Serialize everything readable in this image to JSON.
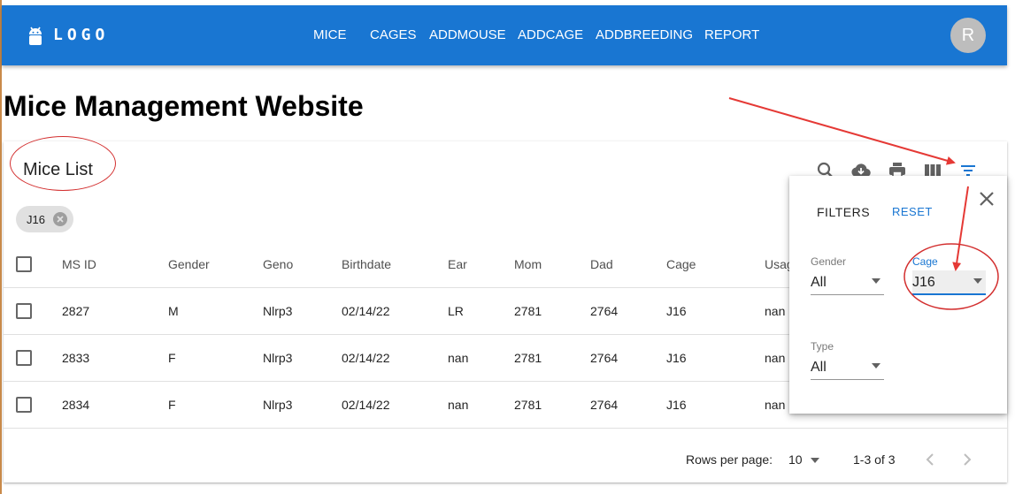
{
  "appbar": {
    "logo_text": "LOGO",
    "logo_icon": "android-icon",
    "nav": [
      "MICE",
      "CAGES",
      "ADDMOUSE",
      "ADDCAGE",
      "ADDBREEDING",
      "REPORT"
    ],
    "avatar_initial": "R",
    "color": "#1976d2"
  },
  "page": {
    "title": "Mice Management Website"
  },
  "list": {
    "title": "Mice List",
    "toolbar_icons": [
      "search-icon",
      "cloud-download-icon",
      "print-icon",
      "view-column-icon",
      "filter-list-icon"
    ],
    "chip": "J16",
    "columns": [
      "MS ID",
      "Gender",
      "Geno",
      "Birthdate",
      "Ear",
      "Mom",
      "Dad",
      "Cage",
      "Usag"
    ],
    "rows": [
      [
        "2827",
        "M",
        "Nlrp3",
        "02/14/22",
        "LR",
        "2781",
        "2764",
        "J16",
        "nan"
      ],
      [
        "2833",
        "F",
        "Nlrp3",
        "02/14/22",
        "nan",
        "2781",
        "2764",
        "J16",
        "nan"
      ],
      [
        "2834",
        "F",
        "Nlrp3",
        "02/14/22",
        "nan",
        "2781",
        "2764",
        "J16",
        "nan"
      ]
    ],
    "rows_peek": [
      "Nlrp3"
    ],
    "rows_per_page_label": "Rows per page:",
    "rows_per_page_value": "10",
    "range": "1-3 of 3"
  },
  "filters": {
    "title": "FILTERS",
    "reset": "RESET",
    "gender_label": "Gender",
    "gender_value": "All",
    "cage_label": "Cage",
    "cage_value": "J16",
    "type_label": "Type",
    "type_value": "All",
    "active_color": "#1976d2"
  },
  "annotation_color": "#e53935"
}
